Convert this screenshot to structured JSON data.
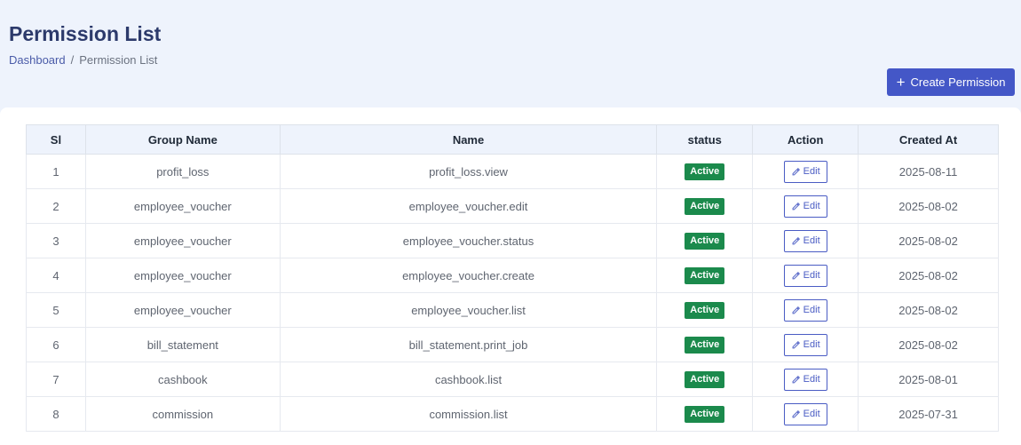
{
  "header": {
    "title": "Permission List",
    "breadcrumb": {
      "home": "Dashboard",
      "separator": "/",
      "current": "Permission List"
    },
    "create_button": {
      "icon": "plus-icon",
      "label": "Create Permission"
    }
  },
  "colors": {
    "accent": "#4457c7",
    "active_badge": "#1b8a4c",
    "page_bg": "#eef3fc"
  },
  "table": {
    "columns": [
      "Sl",
      "Group Name",
      "Name",
      "status",
      "Action",
      "Created At"
    ],
    "edit_label": "Edit",
    "rows": [
      {
        "sl": "1",
        "group": "profit_loss",
        "name": "profit_loss.view",
        "status": "Active",
        "created": "2025-08-11"
      },
      {
        "sl": "2",
        "group": "employee_voucher",
        "name": "employee_voucher.edit",
        "status": "Active",
        "created": "2025-08-02"
      },
      {
        "sl": "3",
        "group": "employee_voucher",
        "name": "employee_voucher.status",
        "status": "Active",
        "created": "2025-08-02"
      },
      {
        "sl": "4",
        "group": "employee_voucher",
        "name": "employee_voucher.create",
        "status": "Active",
        "created": "2025-08-02"
      },
      {
        "sl": "5",
        "group": "employee_voucher",
        "name": "employee_voucher.list",
        "status": "Active",
        "created": "2025-08-02"
      },
      {
        "sl": "6",
        "group": "bill_statement",
        "name": "bill_statement.print_job",
        "status": "Active",
        "created": "2025-08-02"
      },
      {
        "sl": "7",
        "group": "cashbook",
        "name": "cashbook.list",
        "status": "Active",
        "created": "2025-08-01"
      },
      {
        "sl": "8",
        "group": "commission",
        "name": "commission.list",
        "status": "Active",
        "created": "2025-07-31"
      }
    ]
  }
}
